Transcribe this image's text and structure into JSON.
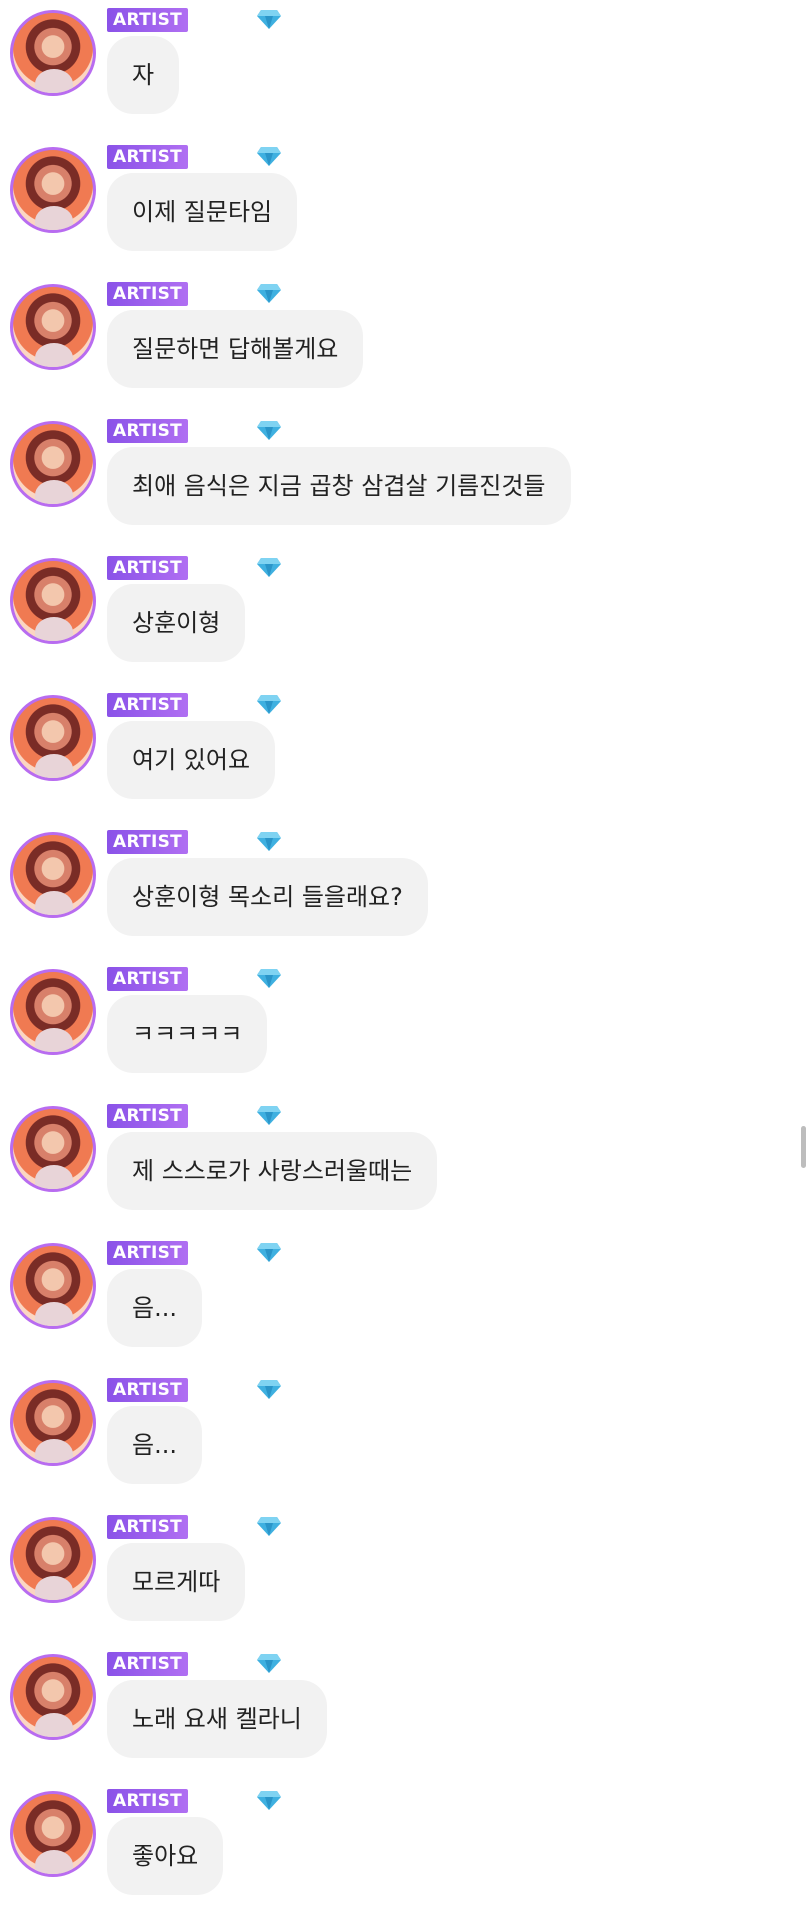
{
  "messages": [
    {
      "badge": "ARTIST",
      "text": "자"
    },
    {
      "badge": "ARTIST",
      "text": "이제 질문타임"
    },
    {
      "badge": "ARTIST",
      "text": "질문하면 답해볼게요"
    },
    {
      "badge": "ARTIST",
      "text": "최애 음식은 지금 곱창 삼겹살 기름진것들"
    },
    {
      "badge": "ARTIST",
      "text": "상훈이형"
    },
    {
      "badge": "ARTIST",
      "text": "여기 있어요"
    },
    {
      "badge": "ARTIST",
      "text": "상훈이형 목소리 들을래요?"
    },
    {
      "badge": "ARTIST",
      "text": "ㅋㅋㅋㅋㅋ"
    },
    {
      "badge": "ARTIST",
      "text": "제 스스로가 사랑스러울때는"
    },
    {
      "badge": "ARTIST",
      "text": "음..."
    },
    {
      "badge": "ARTIST",
      "text": "음..."
    },
    {
      "badge": "ARTIST",
      "text": "모르게따"
    },
    {
      "badge": "ARTIST",
      "text": "노래 요새 켈라니"
    },
    {
      "badge": "ARTIST",
      "text": "좋아요"
    }
  ],
  "icons": {
    "avatar": "artist-avatar",
    "tier": "diamond-icon"
  },
  "colors": {
    "badge": "#9a5ff0",
    "bubble": "#f2f2f2",
    "diamond": "#3fb0e0",
    "avatar_ring": "#b86cf0"
  }
}
